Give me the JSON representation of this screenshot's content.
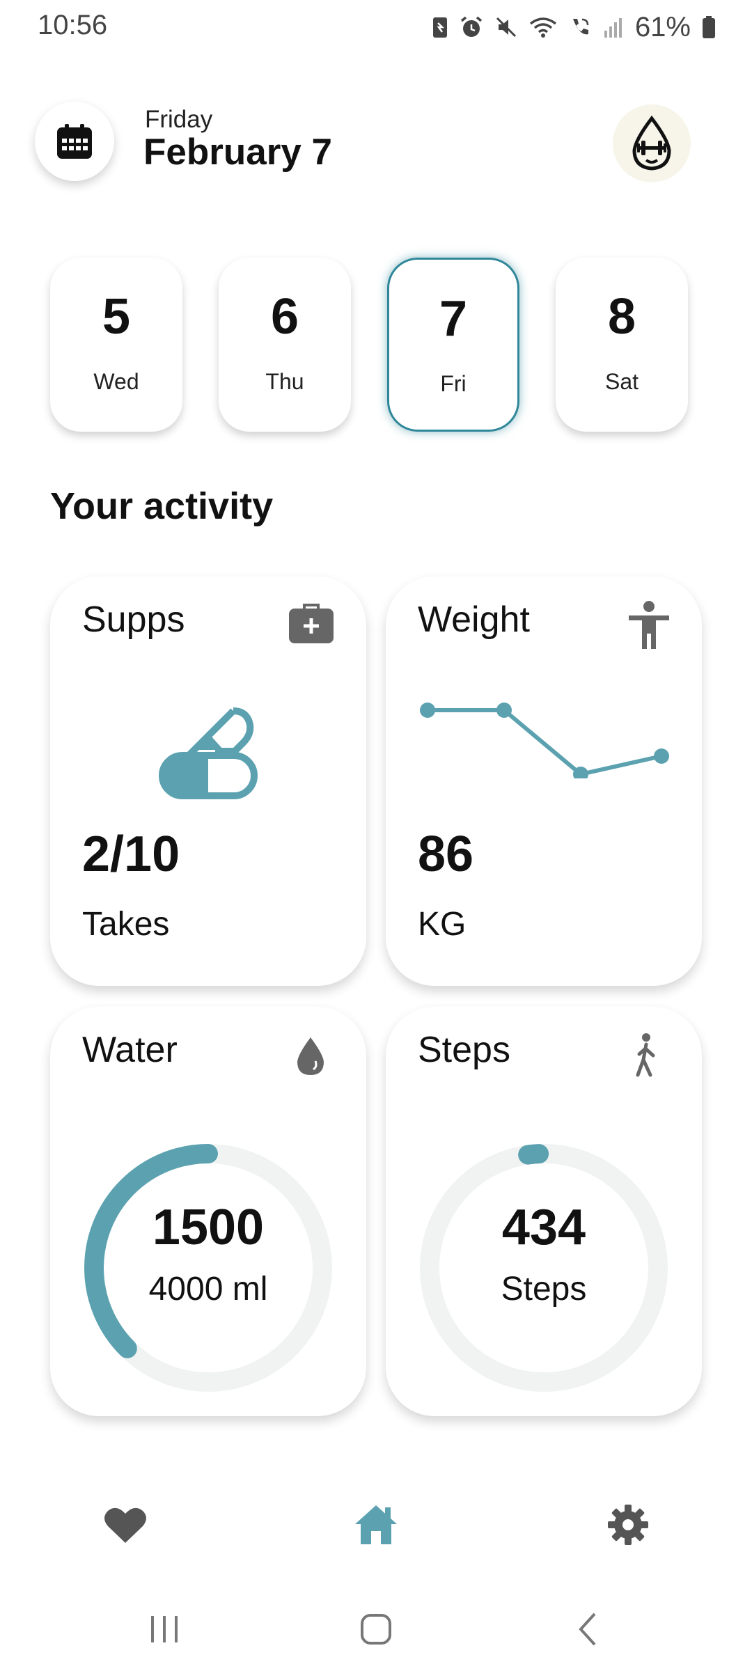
{
  "status_bar": {
    "time": "10:56",
    "battery": "61%"
  },
  "header": {
    "weekday": "Friday",
    "date": "February 7"
  },
  "days": [
    {
      "num": "5",
      "name": "Wed",
      "selected": false
    },
    {
      "num": "6",
      "name": "Thu",
      "selected": false
    },
    {
      "num": "7",
      "name": "Fri",
      "selected": true
    },
    {
      "num": "8",
      "name": "Sat",
      "selected": false
    }
  ],
  "section_title": "Your activity",
  "cards": {
    "supps": {
      "title": "Supps",
      "value": "2/10",
      "unit": "Takes",
      "icon": "first-aid-kit-icon"
    },
    "weight": {
      "title": "Weight",
      "value": "86",
      "unit": "KG",
      "icon": "person-icon",
      "trend": [
        0.0,
        0.0,
        -0.6,
        -0.45
      ]
    },
    "water": {
      "title": "Water",
      "value": "1500",
      "unit": "4000 ml",
      "icon": "water-drop-icon",
      "progress": 0.375
    },
    "steps": {
      "title": "Steps",
      "value": "434",
      "unit": "Steps",
      "icon": "walking-icon",
      "progress": 0.04
    }
  },
  "colors": {
    "accent": "#5ba1b0",
    "ring_track": "#f1f3f3",
    "icon_gray": "#666666"
  },
  "bottom_nav": [
    "heart-icon",
    "home-icon",
    "settings-icon"
  ]
}
